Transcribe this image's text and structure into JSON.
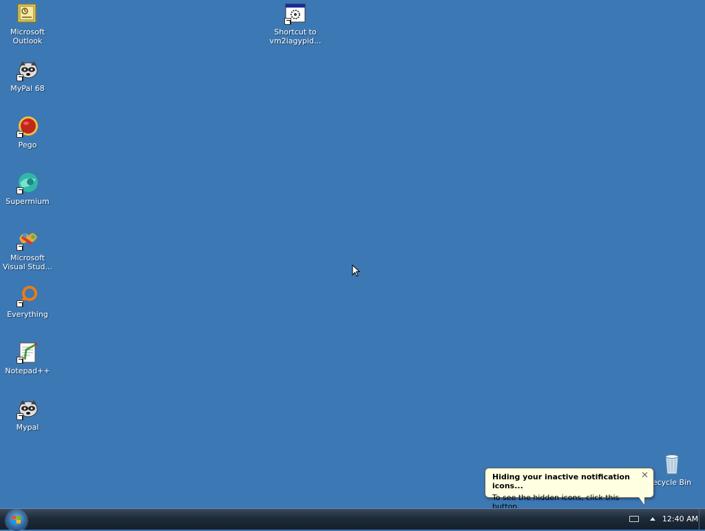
{
  "desktop_icons": [
    {
      "label": "Microsoft\nOutlook"
    },
    {
      "label": "MyPal 68"
    },
    {
      "label": "Pego"
    },
    {
      "label": "Supermium"
    },
    {
      "label": "Microsoft\nVisual Stud..."
    },
    {
      "label": "Everything"
    },
    {
      "label": "Notepad++"
    },
    {
      "label": "Mypal"
    },
    {
      "label": "Shortcut to\nvm2iagypid..."
    },
    {
      "label": "ecycle Bin"
    }
  ],
  "balloon": {
    "title": "Hiding your inactive notification icons...",
    "body": "To see the hidden icons, click this button.",
    "close": "✕"
  },
  "taskbar": {
    "clock": "12:40 AM"
  },
  "colors": {
    "desktop": "#3c78b4",
    "balloon_bg": "#ffffe1"
  }
}
